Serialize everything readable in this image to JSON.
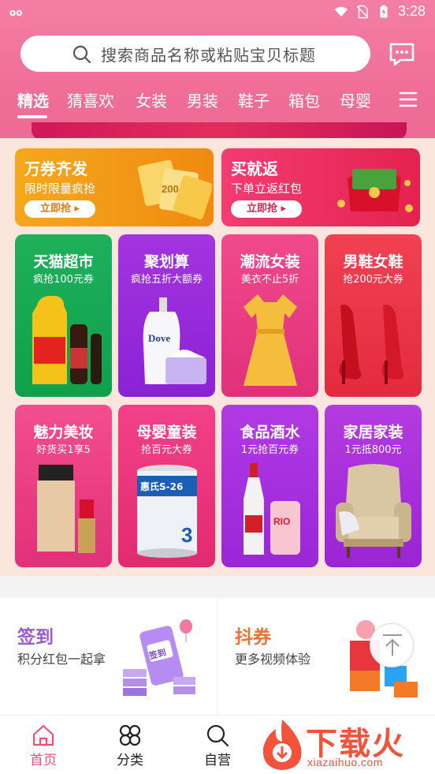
{
  "status_bar": {
    "time": "3:28",
    "left_icon": "oo"
  },
  "search": {
    "placeholder": "搜索商品名称或粘贴宝贝标题"
  },
  "tabs": [
    "精选",
    "猜喜欢",
    "女装",
    "男装",
    "鞋子",
    "箱包",
    "母婴"
  ],
  "coupons": [
    {
      "title": "万券齐发",
      "subtitle": "限时限量疯抢",
      "button": "立即抢 ▸"
    },
    {
      "title": "买就返",
      "subtitle": "下单立返红包",
      "button": "立即抢 ▸"
    }
  ],
  "coupon_art_text": "200",
  "cards": [
    {
      "title": "天猫超市",
      "subtitle": "疯抢100元券"
    },
    {
      "title": "聚划算",
      "subtitle": "疯抢五折大额券"
    },
    {
      "title": "潮流女装",
      "subtitle": "美衣不止5折"
    },
    {
      "title": "男鞋女鞋",
      "subtitle": "抢200元大券"
    },
    {
      "title": "魅力美妆",
      "subtitle": "好货买1享5"
    },
    {
      "title": "母婴童装",
      "subtitle": "抢百元大券"
    },
    {
      "title": "食品酒水",
      "subtitle": "1元抢百元券"
    },
    {
      "title": "家居家装",
      "subtitle": "1元抵800元"
    }
  ],
  "product_art": {
    "dove": "Dove",
    "formula": "惠氏S-26",
    "formula_stage": "3",
    "rio": "RIO",
    "signin_phone": "签到"
  },
  "features": [
    {
      "title": "签到",
      "subtitle": "积分红包一起拿"
    },
    {
      "title": "抖券",
      "subtitle": "更多视频体验"
    }
  ],
  "bottom_nav": [
    {
      "label": "首页",
      "active": true
    },
    {
      "label": "分类",
      "active": false
    },
    {
      "label": "自营",
      "active": false
    }
  ],
  "watermark": {
    "main": "下载火",
    "sub": "xiazaihuo.com"
  },
  "colors": {
    "header_pink": "#f06f99",
    "active_red": "#f0506e",
    "feature_purple": "#9b5bd0",
    "feature_orange": "#f07030"
  }
}
